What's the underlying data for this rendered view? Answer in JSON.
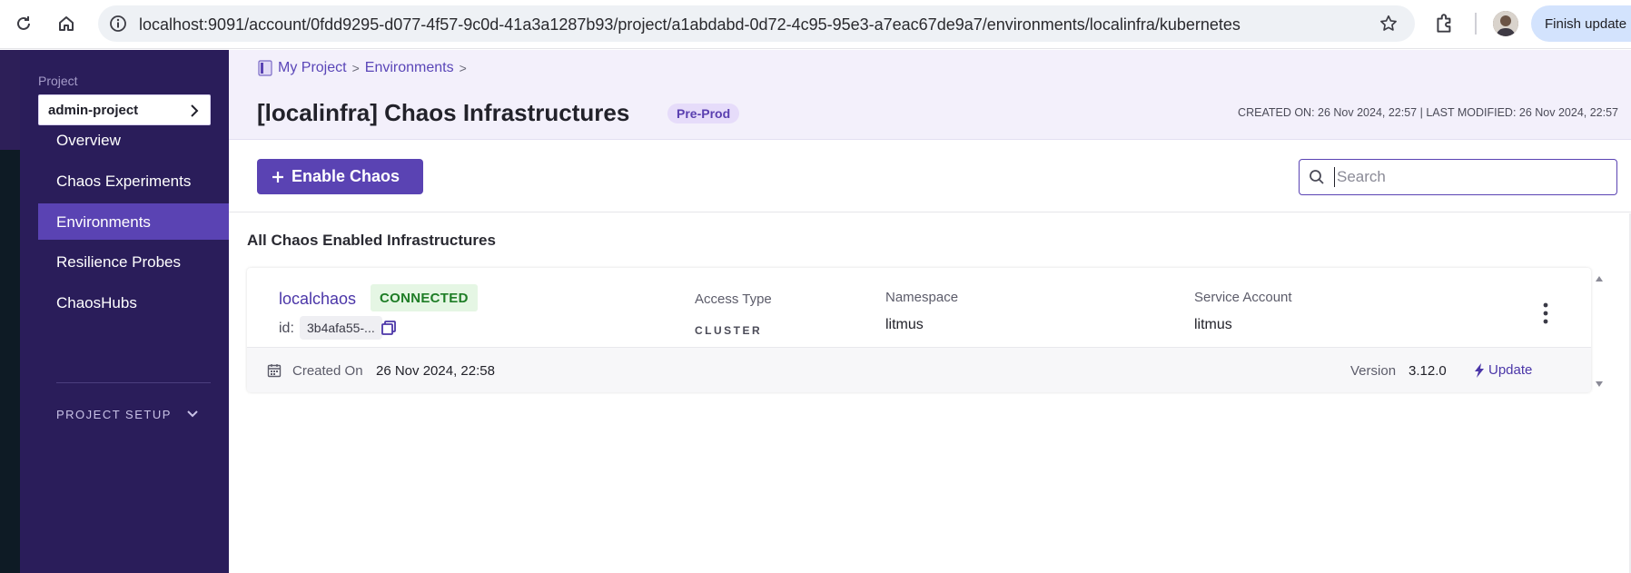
{
  "browser": {
    "url": "localhost:9091/account/0fdd9295-d077-4f57-9c0d-41a3a1287b93/project/a1abdabd-0d72-4c95-95e3-a7eac67de9a7/environments/localinfra/kubernetes",
    "finish_update_label": "Finish update"
  },
  "sidebar": {
    "project_label": "Project",
    "project_name": "admin-project",
    "items": [
      {
        "label": "Overview"
      },
      {
        "label": "Chaos Experiments"
      },
      {
        "label": "Environments",
        "active": true
      },
      {
        "label": "Resilience Probes"
      },
      {
        "label": "ChaosHubs"
      }
    ],
    "setup_label": "PROJECT SETUP"
  },
  "header": {
    "breadcrumbs": [
      "My Project",
      "Environments"
    ],
    "title": "[localinfra] Chaos Infrastructures",
    "env_badge": "Pre-Prod",
    "meta": "CREATED ON: 26 Nov 2024, 22:57 | LAST MODIFIED: 26 Nov 2024, 22:57"
  },
  "toolbar": {
    "enable_label": "Enable Chaos",
    "search_placeholder": "Search",
    "search_value": ""
  },
  "section_title": "All Chaos Enabled Infrastructures",
  "infrastructure": {
    "name": "localchaos",
    "status": "CONNECTED",
    "id_label": "id:",
    "id_value": "3b4afa55-...",
    "access_type_label": "Access Type",
    "access_type_value": "CLUSTER",
    "namespace_label": "Namespace",
    "namespace_value": "litmus",
    "service_account_label": "Service Account",
    "service_account_value": "litmus",
    "created_on_label": "Created On",
    "created_on_value": "26 Nov 2024, 22:58",
    "version_label": "Version",
    "version_value": "3.12.0",
    "update_label": "Update"
  },
  "colors": {
    "sidebar_bg": "#2a1d5a",
    "accent": "#5a43b3",
    "header_bg": "#f3f0fb",
    "connected_bg": "#e5f6e4",
    "connected_text": "#1e7d26"
  },
  "icons": [
    "reload-icon",
    "home-icon",
    "site-info-icon",
    "star-icon",
    "extensions-icon",
    "chevron-right-icon",
    "chevron-down-icon",
    "breadcrumb-project-icon",
    "plus-icon",
    "search-icon",
    "copy-icon",
    "more-vertical-icon",
    "calendar-icon",
    "lightning-icon"
  ]
}
